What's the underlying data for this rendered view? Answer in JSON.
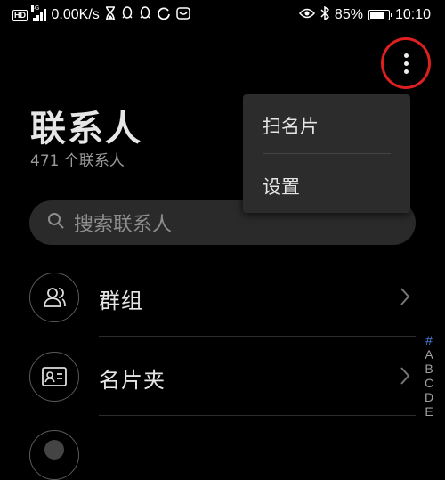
{
  "status_bar": {
    "network_badge": "HD",
    "network_gen": "4G",
    "speed": "0.00K/s",
    "battery_percent": "85%",
    "battery_level": 0.85,
    "time": "10:10",
    "left_icons": [
      "hourglass-icon",
      "qq-icon",
      "qq-icon",
      "circle-icon",
      "app-icon"
    ],
    "right_icons": [
      "eye-icon",
      "bluetooth-icon",
      "battery-icon"
    ]
  },
  "header": {
    "title": "联系人",
    "count_label": "471 个联系人"
  },
  "search": {
    "placeholder": "搜索联系人"
  },
  "list": {
    "items": [
      {
        "label": "群组",
        "icon": "group-icon"
      },
      {
        "label": "名片夹",
        "icon": "card-holder-icon"
      }
    ]
  },
  "menu": {
    "items": [
      {
        "label": "扫名片"
      },
      {
        "label": "设置"
      }
    ]
  },
  "index_bar": {
    "letters": [
      "#",
      "A",
      "B",
      "C",
      "D",
      "E"
    ]
  },
  "colors": {
    "background": "#000000",
    "highlight_circle": "#e02020",
    "index_hash": "#4a7fe0"
  }
}
